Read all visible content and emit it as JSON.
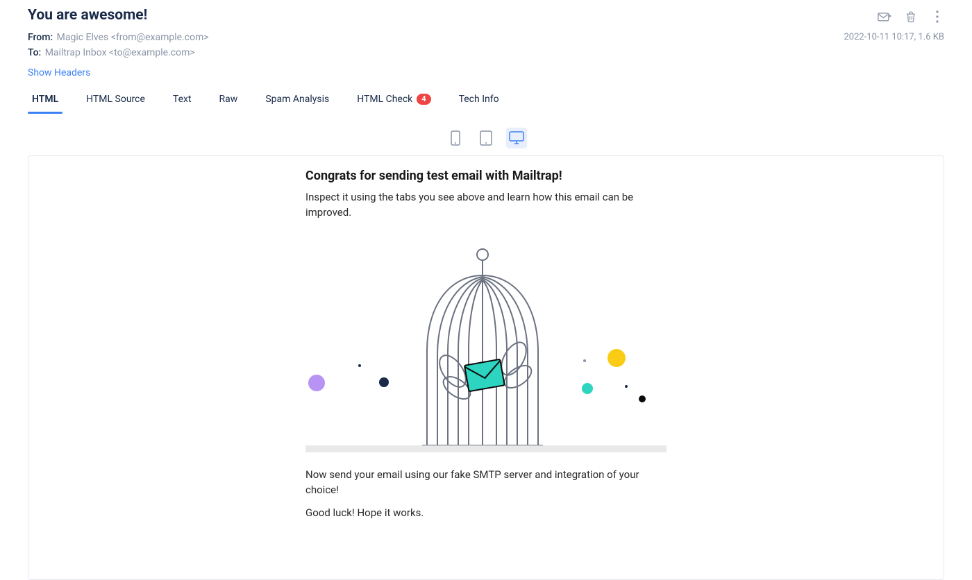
{
  "email": {
    "subject": "You are awesome!",
    "from_label": "From:",
    "from_value": "Magic Elves <from@example.com>",
    "to_label": "To:",
    "to_value": "Mailtrap Inbox <to@example.com>",
    "date_size": "2022-10-11 10:17, 1.6 KB",
    "show_headers": "Show Headers"
  },
  "tabs": {
    "html": "HTML",
    "html_source": "HTML Source",
    "text": "Text",
    "raw": "Raw",
    "spam": "Spam Analysis",
    "html_check": "HTML Check",
    "html_check_badge": "4",
    "tech_info": "Tech Info"
  },
  "icons": {
    "forward": "forward-icon",
    "delete": "trash-icon",
    "more": "more-icon",
    "mobile": "mobile-icon",
    "tablet": "tablet-icon",
    "desktop": "desktop-icon"
  },
  "preview": {
    "heading": "Congrats for sending test email with Mailtrap!",
    "p1": "Inspect it using the tabs you see above and learn how this email can be improved.",
    "p2": "Now send your email using our fake SMTP server and integration of your choice!",
    "p3": "Good luck! Hope it works."
  },
  "dots": {
    "lavender": "#b794f4",
    "navy": "#1a2b49",
    "teal": "#2dd4bf",
    "yellow": "#facc15",
    "black": "#0b0b0b"
  }
}
